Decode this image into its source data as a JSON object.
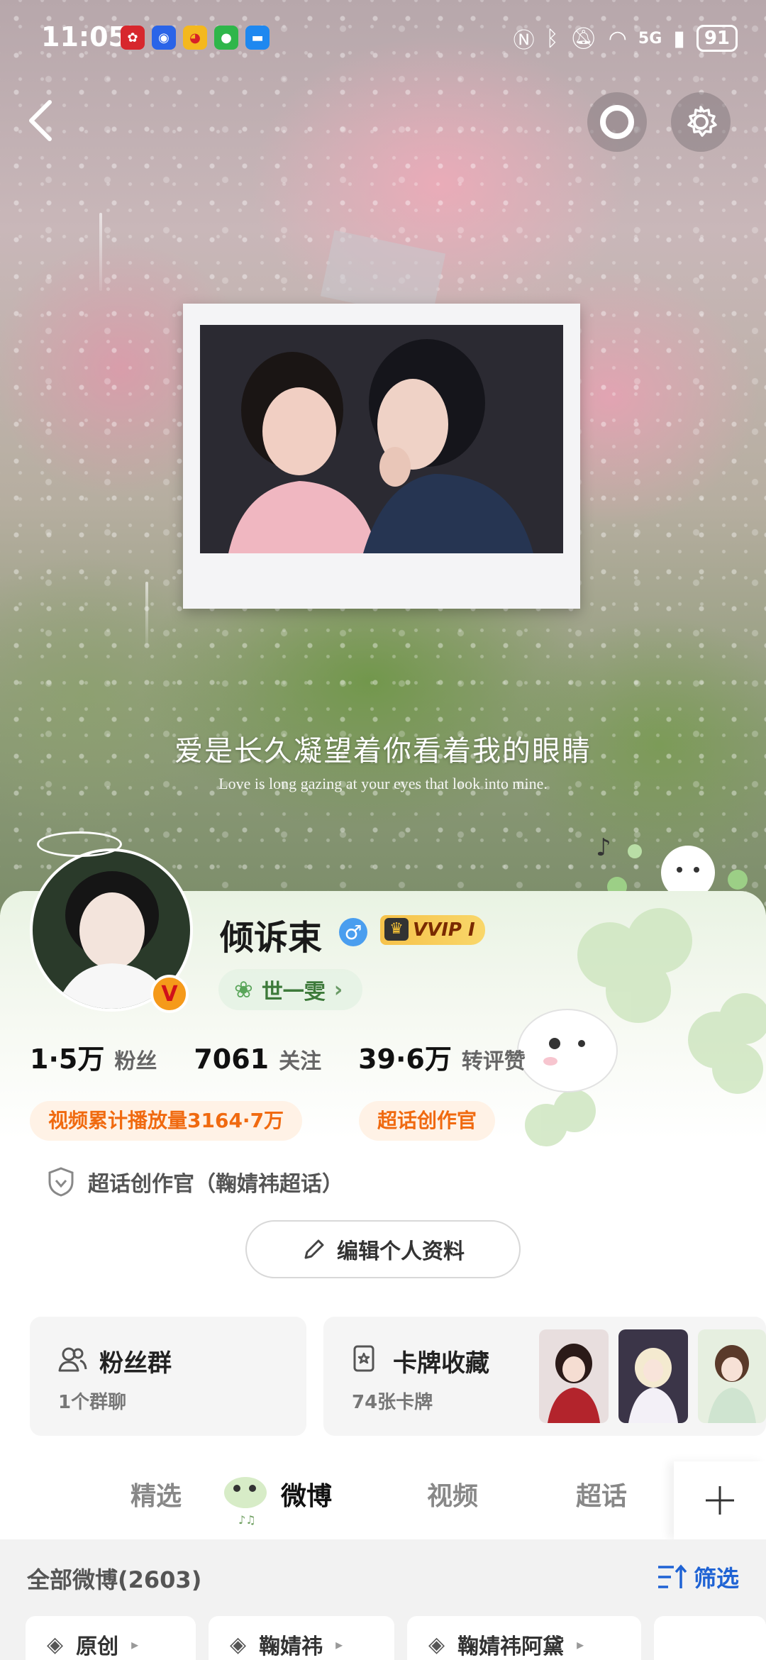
{
  "status_bar": {
    "time": "11:05",
    "network": "5G",
    "battery": "91"
  },
  "cover": {
    "quote_cn": "爱是长久凝望着你看着我的眼睛",
    "quote_en": "Love is long gazing at your eyes that look into mine."
  },
  "profile": {
    "name": "倾诉束",
    "vip_label": "VVIP I",
    "tag": "世一雯",
    "stats": [
      {
        "value": "1·5万",
        "label": "粉丝"
      },
      {
        "value": "7061",
        "label": "关注"
      },
      {
        "value": "39·6万",
        "label": "转评赞"
      }
    ],
    "pill_video": "视频累计播放量3164·7万",
    "pill_creator": "超话创作官",
    "badge_text": "超话创作官（鞠婧祎超话）",
    "edit_label": "编辑个人资料"
  },
  "tiles": {
    "fans_group": {
      "title": "粉丝群",
      "sub": "1个群聊"
    },
    "cards": {
      "title": "卡牌收藏",
      "sub": "74张卡牌"
    }
  },
  "tabs": [
    "精选",
    "微博",
    "视频",
    "超话"
  ],
  "feed": {
    "count_label": "全部微博(2603)",
    "filter_label": "筛选",
    "chips": [
      "原创",
      "鞠婧祎",
      "鞠婧祎阿黛"
    ]
  }
}
